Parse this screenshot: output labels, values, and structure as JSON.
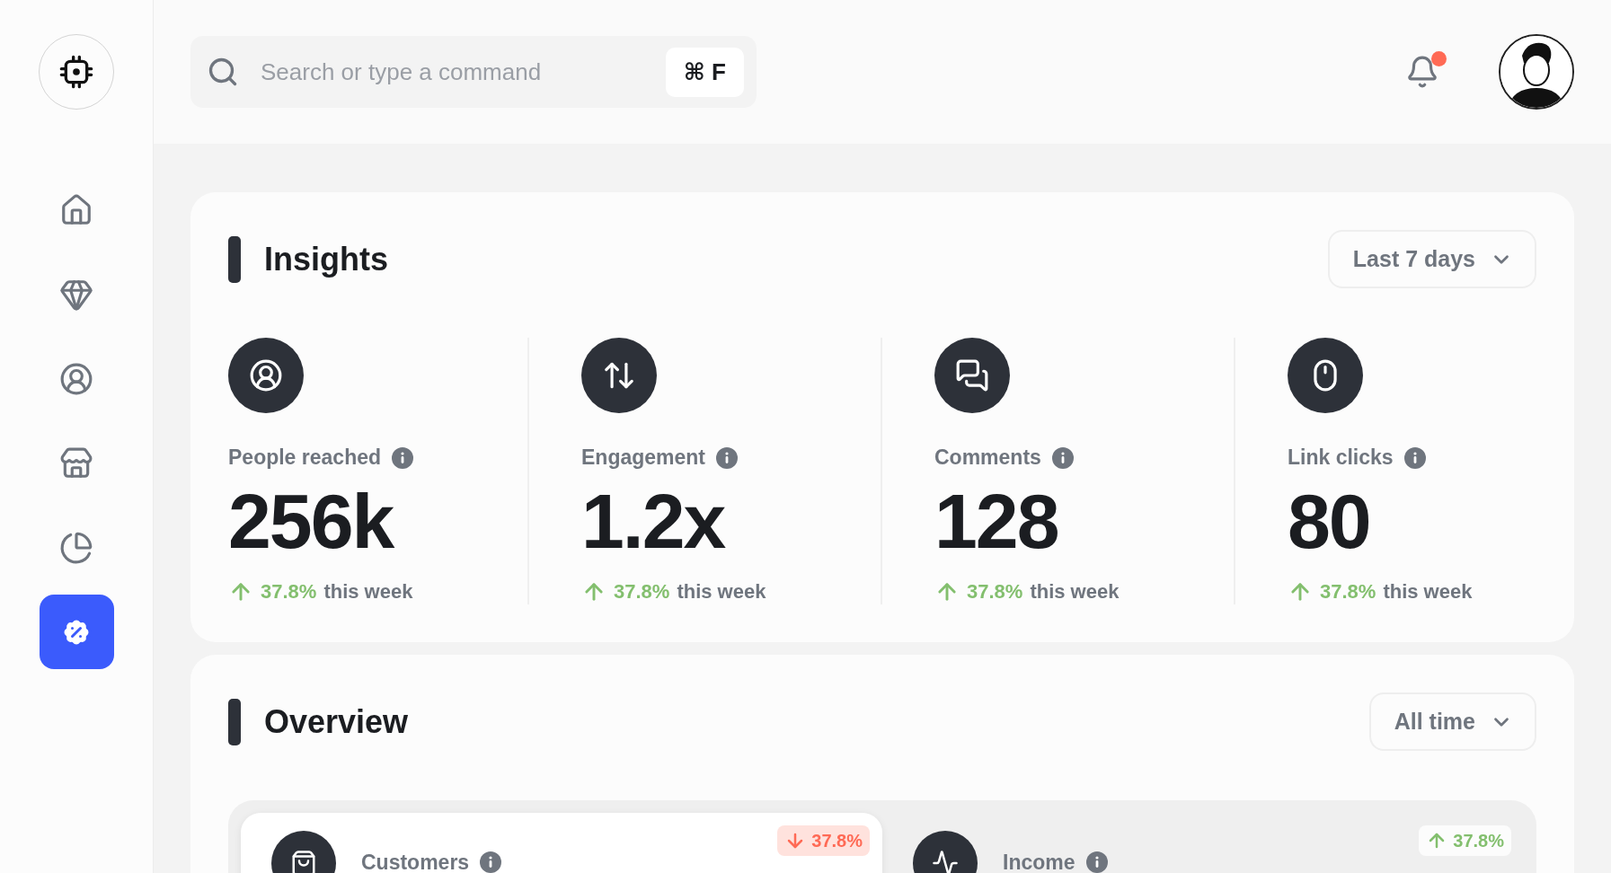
{
  "sidebar": {
    "items": [
      {
        "kind": "home",
        "selected": false
      },
      {
        "kind": "diamond",
        "selected": false
      },
      {
        "kind": "user",
        "selected": false
      },
      {
        "kind": "store",
        "selected": false
      },
      {
        "kind": "chart",
        "selected": false
      },
      {
        "kind": "discount",
        "selected": true
      }
    ]
  },
  "topbar": {
    "search": {
      "placeholder": "Search or type a command",
      "shortcut": "⌘ F"
    },
    "notifications": {
      "unread": true
    }
  },
  "insights": {
    "title": "Insights",
    "range": "Last 7 days",
    "stats": [
      {
        "kind": "people",
        "label": "People reached",
        "value": "256k",
        "change": "37.8%",
        "rising": true,
        "period": "this week"
      },
      {
        "kind": "engagement",
        "label": "Engagement",
        "value": "1.2x",
        "change": "37.8%",
        "rising": true,
        "period": "this week"
      },
      {
        "kind": "comments",
        "label": "Comments",
        "value": "128",
        "change": "37.8%",
        "rising": true,
        "period": "this week"
      },
      {
        "kind": "clicks",
        "label": "Link clicks",
        "value": "80",
        "change": "37.8%",
        "rising": true,
        "period": "this week"
      }
    ]
  },
  "overview": {
    "title": "Overview",
    "range": "All time",
    "metrics": [
      {
        "kind": "customers",
        "label": "Customers",
        "change": "37.8%",
        "rising": false,
        "selected": true
      },
      {
        "kind": "income",
        "label": "Income",
        "change": "37.8%",
        "rising": true,
        "selected": false
      }
    ]
  }
}
